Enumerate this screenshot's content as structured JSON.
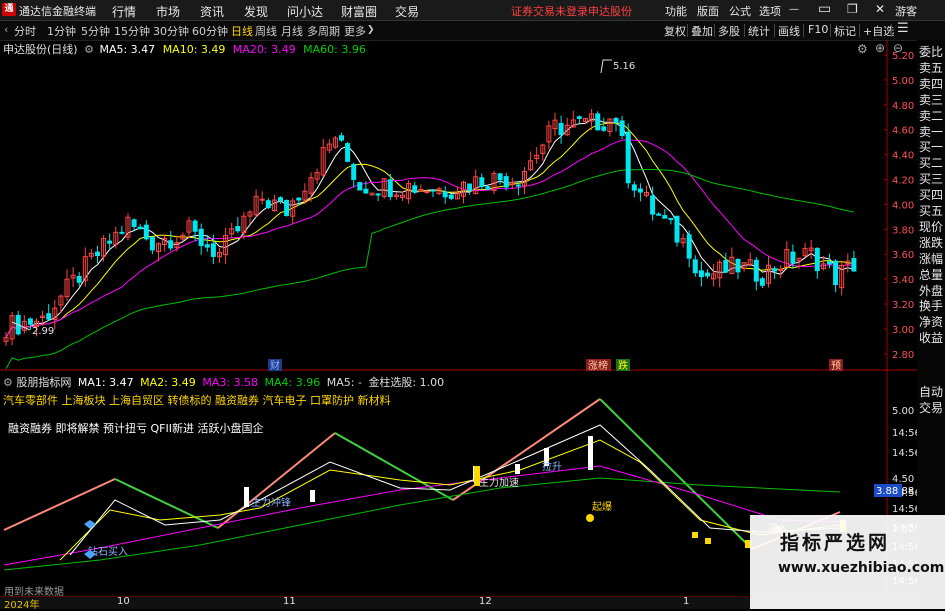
{
  "app": {
    "title": "通达信金融终端",
    "logo": "通",
    "login_status": "证券交易未登录",
    "stock_tab": "申达股份"
  },
  "menu": [
    "行情",
    "市场",
    "资讯",
    "发现",
    "问小达",
    "财富圈",
    "交易"
  ],
  "right_menu": [
    "功能",
    "版面",
    "公式",
    "选项",
    "游客"
  ],
  "periods": [
    "分时",
    "1分钟",
    "5分钟",
    "15分钟",
    "30分钟",
    "60分钟",
    "日线",
    "周线",
    "月线",
    "多周期",
    "更多"
  ],
  "active_period": "日线",
  "toolbar": [
    "复权",
    "叠加",
    "多股",
    "统计",
    "画线",
    "F10",
    "标记",
    "+自选"
  ],
  "main_legend": {
    "name": "申达股份(日线)",
    "ma5": "MA5: 3.47",
    "ma10": "MA10: 3.49",
    "ma20": "MA20: 3.49",
    "ma60": "MA60: 3.96"
  },
  "sub_legend": {
    "name": "股朋指标网",
    "ma1": "MA1: 3.47",
    "ma2": "MA2: 3.49",
    "ma3": "MA3: 3.58",
    "ma4": "MA4: 3.96",
    "ma5": "MA5: -",
    "extra": "金柱选股: 1.00"
  },
  "concepts_line1": "汽车零部件 上海板块 上海自贸区 转债标的 融资融券 汽车电子 口罩防护 新材料",
  "concepts_line2": "融资融券 即将解禁 预计扭亏 QFII新进 活跃小盘国企",
  "right_panel": [
    "委比",
    "卖五",
    "卖四",
    "卖三",
    "卖二",
    "卖一",
    "买一",
    "买二",
    "买三",
    "买四",
    "买五",
    "现价",
    "涨跌",
    "涨幅",
    "总量",
    "外盘",
    "换手",
    "净资",
    "收益"
  ],
  "right_panel_sub": [
    "自动",
    "交易"
  ],
  "price_axis": [
    "5.20",
    "5.00",
    "4.80",
    "4.60",
    "4.40",
    "4.20",
    "4.00",
    "3.80",
    "3.60",
    "3.40",
    "3.20",
    "3.00",
    "2.80"
  ],
  "sub_axis": [
    "5.00",
    "14:56",
    "14:56",
    "4.50",
    "14:56",
    "14:56",
    "14:56",
    "3.88",
    "14:56",
    "3.50",
    "14:56",
    "14:56"
  ],
  "high_label": "5.16",
  "low_label": "2.99",
  "markers": [
    {
      "t": "财"
    },
    {
      "t": "涨榜"
    },
    {
      "t": "跌"
    },
    {
      "t": "预"
    }
  ],
  "sub_labels": [
    "钻石买入",
    "主力冲锋",
    "主力加速",
    "起爆",
    "买入",
    "拉升"
  ],
  "x_axis": [
    "2024年",
    "10",
    "11",
    "12",
    "1"
  ],
  "footer": "用到未来数据",
  "colors": {
    "up": "#ff4444",
    "down": "#00e5ee",
    "ma5": "#ffffff",
    "ma10": "#ffff00",
    "ma20": "#ff00ff",
    "ma60": "#00c000",
    "zig_up": "#ff8a7a",
    "zig_down": "#40d040"
  },
  "watermark": {
    "line1": "指标严选网",
    "line2": "www.xuezhibiao.com"
  }
}
